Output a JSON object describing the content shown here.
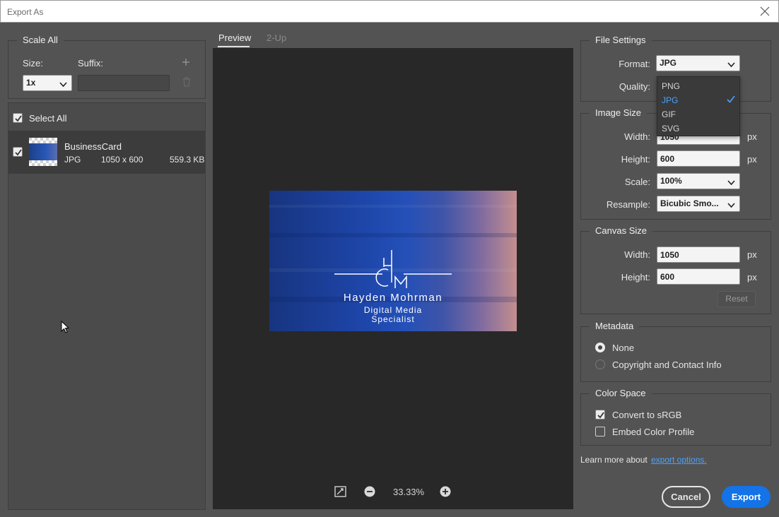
{
  "window": {
    "title": "Export As"
  },
  "scale_all": {
    "title": "Scale All",
    "size_label": "Size:",
    "suffix_label": "Suffix:",
    "size_value": "1x",
    "suffix_value": ""
  },
  "assets": {
    "select_all_label": "Select All",
    "items": [
      {
        "name": "BusinessCard",
        "format": "JPG",
        "dimensions": "1050 x 600",
        "filesize": "559.3 KB"
      }
    ]
  },
  "preview": {
    "tabs": [
      {
        "label": "Preview"
      },
      {
        "label": "2-Up"
      }
    ],
    "zoom": "33.33%",
    "card": {
      "name": "Hayden Mohrman",
      "line1": "Digital Media",
      "line2": "Specialist",
      "monogram": "HM"
    }
  },
  "file_settings": {
    "title": "File Settings",
    "format_label": "Format:",
    "format_value": "JPG",
    "quality_label": "Quality:",
    "format_options": [
      "PNG",
      "JPG",
      "GIF",
      "SVG"
    ],
    "selected_option": "JPG"
  },
  "image_size": {
    "title": "Image Size",
    "width_label": "Width:",
    "width_value": "1050",
    "height_label": "Height:",
    "height_value": "600",
    "scale_label": "Scale:",
    "scale_value": "100%",
    "resample_label": "Resample:",
    "resample_value": "Bicubic Smo...",
    "unit": "px"
  },
  "canvas_size": {
    "title": "Canvas Size",
    "width_label": "Width:",
    "width_value": "1050",
    "height_label": "Height:",
    "height_value": "600",
    "unit": "px",
    "reset_label": "Reset"
  },
  "metadata": {
    "title": "Metadata",
    "options": [
      {
        "label": "None",
        "checked": true
      },
      {
        "label": "Copyright and Contact Info",
        "checked": false
      }
    ]
  },
  "color_space": {
    "title": "Color Space",
    "convert_label": "Convert to sRGB",
    "embed_label": "Embed Color Profile"
  },
  "footer": {
    "learn_more": "Learn more about",
    "link": "export options.",
    "cancel": "Cancel",
    "export": "Export"
  },
  "colors": {
    "accent": "#1473e6",
    "panel": "#535353",
    "preview_bg": "#282828",
    "link": "#4aa3ff"
  }
}
